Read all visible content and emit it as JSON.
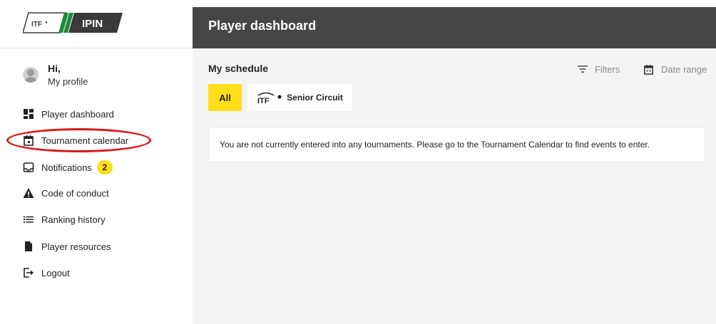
{
  "brand": {
    "itf_mark": "ITF",
    "app_name": "IPIN",
    "green": "#1f8a3a",
    "dark": "#3a3a3a"
  },
  "user": {
    "greeting": "Hi,",
    "profile_link": "My profile"
  },
  "sidebar": {
    "items": [
      {
        "label": "Player dashboard",
        "icon": "dashboard-icon"
      },
      {
        "label": "Tournament calendar",
        "icon": "calendar-icon",
        "highlighted": true
      },
      {
        "label": "Notifications",
        "icon": "notifications-icon",
        "badge": "2"
      },
      {
        "label": "Code of conduct",
        "icon": "warning-icon"
      },
      {
        "label": "Ranking history",
        "icon": "list-icon"
      },
      {
        "label": "Player resources",
        "icon": "document-icon"
      },
      {
        "label": "Logout",
        "icon": "logout-icon"
      }
    ]
  },
  "header": {
    "title": "Player dashboard"
  },
  "schedule": {
    "title": "My schedule",
    "filters_label": "Filters",
    "date_range_label": "Date range",
    "tabs": [
      {
        "label": "All",
        "active": true
      },
      {
        "label": "Senior Circuit",
        "logo": "ITF",
        "active": false
      }
    ],
    "empty_message": "You are not currently entered into any tournaments. Please go to the Tournament Calendar to find events to enter."
  },
  "colors": {
    "accent_yellow": "#ffde1a",
    "header_bg": "#464646",
    "highlight_red": "#d61a1a"
  }
}
